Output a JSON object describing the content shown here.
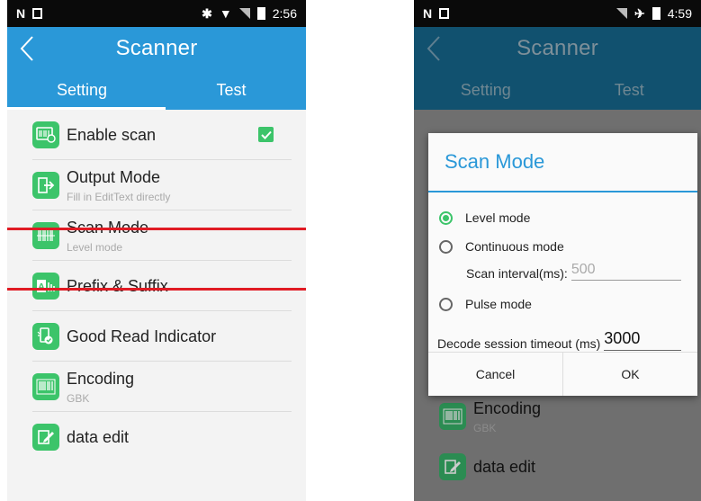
{
  "left": {
    "status": {
      "time": "2:56"
    },
    "appbar": {
      "title": "Scanner"
    },
    "tabs": [
      {
        "label": "Setting"
      },
      {
        "label": "Test"
      }
    ],
    "items": [
      {
        "label": "Enable scan",
        "icon": "barcode-scan-icon",
        "checked": true
      },
      {
        "label": "Output Mode",
        "sub": "Fill in EditText directly",
        "icon": "output-arrow-icon"
      },
      {
        "label": "Scan Mode",
        "sub": "Level mode",
        "icon": "scan-mode-icon"
      },
      {
        "label": "Prefix & Suffix",
        "icon": "prefix-suffix-icon"
      },
      {
        "label": "Good Read Indicator",
        "icon": "good-read-indicator-icon"
      },
      {
        "label": "Encoding",
        "sub": "GBK",
        "icon": "barcode-icon"
      },
      {
        "label": "data edit",
        "icon": "edit-icon"
      }
    ]
  },
  "right": {
    "status": {
      "time": "4:59"
    },
    "appbar": {
      "title": "Scanner"
    },
    "tabs": [
      {
        "label": "Setting"
      },
      {
        "label": "Test"
      }
    ],
    "dialog": {
      "title": "Scan Mode",
      "options": [
        {
          "label": "Level mode",
          "selected": true
        },
        {
          "label": "Continuous mode",
          "selected": false
        },
        {
          "label": "Pulse mode",
          "selected": false
        }
      ],
      "interval_label": "Scan interval(ms):",
      "interval_value": "500",
      "timeout_label": "Decode session timeout (ms)",
      "timeout_value": "3000",
      "cancel": "Cancel",
      "ok": "OK"
    },
    "background_items": [
      {
        "label": "Encoding",
        "sub": "GBK"
      },
      {
        "label": "data edit"
      }
    ]
  },
  "colors": {
    "primary": "#2a98d8",
    "accent": "#3cc46a",
    "highlight": "#e01b24",
    "dimmed_bar": "#11516f"
  }
}
